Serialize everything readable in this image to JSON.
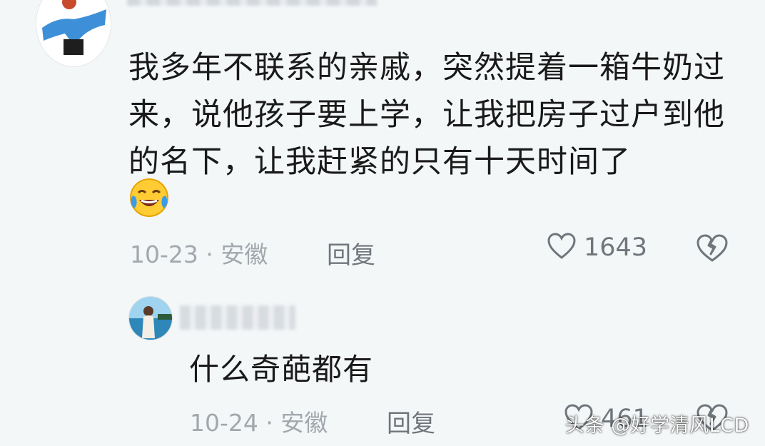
{
  "comment": {
    "text": "我多年不联系的亲戚，突然提着一箱牛奶过来，说他孩子要上学，让我把房子过户到他的名下，让我赶紧的只有十天时间了",
    "emoji_icon": "laughing-tears-emoji",
    "date_location": "10-23 · 安徽",
    "reply_label": "回复",
    "like_count": "1643",
    "icons": {
      "like": "heart-outline-icon",
      "dislike": "broken-heart-icon"
    }
  },
  "reply": {
    "text": "什么奇葩都有",
    "date_location": "10-24 · 安徽",
    "reply_label": "回复",
    "like_count_partial": "461"
  },
  "watermark": "头条 @好学清风LCD",
  "colors": {
    "background": "#f4f7f8",
    "text": "#1a1a1a",
    "meta": "#a2a8ad",
    "action": "#6f767c"
  }
}
